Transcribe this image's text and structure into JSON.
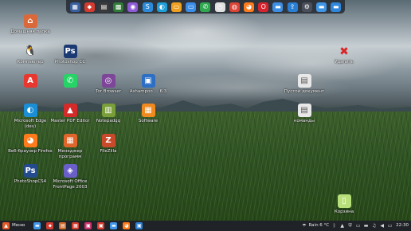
{
  "colors": {
    "taskbar": "#1f2227",
    "dock": "#282c34",
    "accent_red": "#e8372f",
    "accent_blue": "#2d7fd3"
  },
  "top_dock": {
    "items": [
      {
        "name": "virtualbox-icon",
        "glyph": "▦",
        "color": "#3a5f9e"
      },
      {
        "name": "anydesk-icon",
        "glyph": "⬥",
        "color": "#d33b2f"
      },
      {
        "name": "pdf-reader-icon",
        "glyph": "▤",
        "color": "#3a3a3a"
      },
      {
        "name": "torrent-icon",
        "glyph": "▩",
        "color": "#2f7a36"
      },
      {
        "name": "camera-icon",
        "glyph": "◉",
        "color": "#8f5ad6"
      },
      {
        "name": "sync-icon",
        "glyph": "S",
        "color": "#2c8bd9"
      },
      {
        "name": "edge-icon",
        "glyph": "◐",
        "color": "#1f9ed8"
      },
      {
        "name": "monitor-icon",
        "glyph": "▭",
        "color": "#f0a020"
      },
      {
        "name": "monitor2-icon",
        "glyph": "▭",
        "color": "#3a8ee6"
      },
      {
        "name": "phone-icon",
        "glyph": "✆",
        "color": "#2fa84f"
      },
      {
        "name": "clock-icon",
        "glyph": "◷",
        "color": "#e0e0e0"
      },
      {
        "name": "chrome-icon",
        "glyph": "◍",
        "color": "#db4437"
      },
      {
        "name": "firefox-icon",
        "glyph": "◕",
        "color": "#ff7a1a"
      },
      {
        "name": "opera-icon",
        "glyph": "O",
        "color": "#d6232e"
      },
      {
        "name": "files-icon",
        "glyph": "▬",
        "color": "#3d8fe3"
      },
      {
        "name": "upload-icon",
        "glyph": "⇪",
        "color": "#2a7fd2"
      },
      {
        "name": "settings-icon",
        "glyph": "⚙",
        "color": "#4a4f59"
      },
      {
        "name": "folder-icon",
        "glyph": "▬",
        "color": "#3f96e6"
      },
      {
        "name": "folder2-icon",
        "glyph": "▬",
        "color": "#2f86da"
      }
    ]
  },
  "desktop": {
    "icons": [
      {
        "name": "home-folder",
        "label": "Домашняя папка",
        "glyph": "⌂",
        "color": "#d9683a"
      },
      {
        "name": "computer",
        "label": "Компьютер",
        "glyph": "🐧",
        "color": "#2b2b2b"
      },
      {
        "name": "photoshop-cc",
        "label": "Photoshop CC",
        "glyph": "Ps",
        "color": "#1b3a73"
      },
      {
        "name": "adobe-app",
        "label": "",
        "glyph": "A",
        "color": "#e8372f"
      },
      {
        "name": "whatsapp",
        "label": "",
        "glyph": "✆",
        "color": "#25d366"
      },
      {
        "name": "tor-browser",
        "label": "Tor Browser",
        "glyph": "◎",
        "color": "#7d4698"
      },
      {
        "name": "app-63",
        "label": "Ashampoo ... 6.3",
        "glyph": "▣",
        "color": "#2d6fc4"
      },
      {
        "name": "delete-icon",
        "label": "Удалить",
        "glyph": "✖",
        "color": "#d82525"
      },
      {
        "name": "empty-document",
        "label": "Пустой документ",
        "glyph": "▤",
        "color": "#e8e8e8"
      },
      {
        "name": "edge-dev",
        "label": "Microsoft Edge (dev)",
        "glyph": "◐",
        "color": "#1b8fd6"
      },
      {
        "name": "master-pdf",
        "label": "Master PDF Editor",
        "glyph": "▲",
        "color": "#d42a2a"
      },
      {
        "name": "notepadqq",
        "label": "Notepadqq",
        "glyph": "▥",
        "color": "#7a9e3a"
      },
      {
        "name": "software",
        "label": "Software",
        "glyph": "▦",
        "color": "#f08a1e"
      },
      {
        "name": "commands",
        "label": "команды",
        "glyph": "▤",
        "color": "#e8e8e8"
      },
      {
        "name": "firefox",
        "label": "Веб-браузер Firefox",
        "glyph": "◕",
        "color": "#ff7a1a"
      },
      {
        "name": "program-manager",
        "label": "Менеджер программ",
        "glyph": "▦",
        "color": "#e0652a"
      },
      {
        "name": "filezilla",
        "label": "FileZilla",
        "glyph": "Z",
        "color": "#c94a2a"
      },
      {
        "name": "photoshop-cs4",
        "label": "PhotoShopCS4",
        "glyph": "Ps",
        "color": "#254b8f"
      },
      {
        "name": "frontpage",
        "label": "Microsoft Office FrontPage 2003",
        "glyph": "◈",
        "color": "#6a5fc9"
      },
      {
        "name": "trash",
        "label": "Корзина",
        "glyph": "▯",
        "color": "#b8e07a"
      }
    ]
  },
  "taskbar": {
    "menu_label": "Меню",
    "weather": "Rain 6 °C",
    "time": "22:30",
    "apps": [
      {
        "name": "files-app-icon",
        "glyph": "▬",
        "color": "#3f96e6"
      },
      {
        "name": "anydesk-app-icon",
        "glyph": "⬥",
        "color": "#d33b2f"
      },
      {
        "name": "pdf-app-icon",
        "glyph": "▤",
        "color": "#d06a2a"
      },
      {
        "name": "app4-icon",
        "glyph": "▦",
        "color": "#d33b2f"
      },
      {
        "name": "app5-icon",
        "glyph": "▣",
        "color": "#c8326b"
      },
      {
        "name": "app6-icon",
        "glyph": "▣",
        "color": "#d33b2f"
      },
      {
        "name": "folder-app-icon",
        "glyph": "▬",
        "color": "#3f96e6"
      },
      {
        "name": "firefox-app-icon",
        "glyph": "◕",
        "color": "#ff7a1a"
      },
      {
        "name": "store-app-icon",
        "glyph": "▣",
        "color": "#2d7fd3"
      }
    ],
    "tray": [
      {
        "name": "weather-icon",
        "glyph": "☂"
      },
      {
        "name": "bluetooth-icon",
        "glyph": "ᛒ"
      },
      {
        "name": "network-icon",
        "glyph": "▲"
      },
      {
        "name": "shield-icon",
        "glyph": "⛨"
      },
      {
        "name": "keyboard-icon",
        "glyph": "▭"
      },
      {
        "name": "flag-icon",
        "glyph": "▬"
      },
      {
        "name": "music-icon",
        "glyph": "♫"
      },
      {
        "name": "volume-icon",
        "glyph": "◀"
      },
      {
        "name": "screen-icon",
        "glyph": "▭"
      }
    ]
  }
}
